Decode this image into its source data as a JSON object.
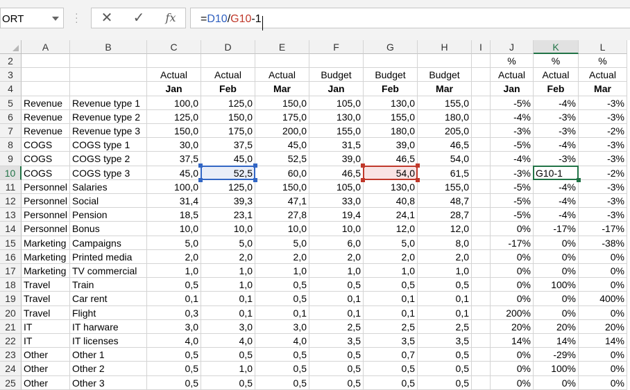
{
  "name_box": {
    "value": "ORT"
  },
  "formula_bar": {
    "cancel_icon": "✕",
    "enter_icon": "✓",
    "fx_label": "fx",
    "formula_parts": [
      {
        "text": "=",
        "color": "#000000"
      },
      {
        "text": "D10",
        "color": "#2f5fbf"
      },
      {
        "text": "/",
        "color": "#000000"
      },
      {
        "text": "G10",
        "color": "#c0392b"
      },
      {
        "text": "-1",
        "color": "#000000"
      }
    ]
  },
  "colors": {
    "ref1_border": "#3266c4",
    "ref1_fill": "#e9eef8",
    "ref2_border": "#c0392b",
    "ref2_fill": "#f9e4e4",
    "active_border": "#217346",
    "header_selected": "#217346"
  },
  "grid": {
    "columns": [
      "A",
      "B",
      "C",
      "D",
      "E",
      "F",
      "G",
      "H",
      "I",
      "J",
      "K",
      "L"
    ],
    "selected_column": "K",
    "selected_row": "10",
    "rows": [
      {
        "num": "2",
        "cells": [
          "",
          "",
          "",
          "",
          "",
          "",
          "",
          "",
          "",
          "%",
          "%",
          "%"
        ]
      },
      {
        "num": "3",
        "cells": [
          "",
          "",
          "Actual",
          "Actual",
          "Actual",
          "Budget",
          "Budget",
          "Budget",
          "",
          "Actual",
          "Actual",
          "Actual"
        ]
      },
      {
        "num": "4",
        "cells": [
          "",
          "",
          "Jan",
          "Feb",
          "Mar",
          "Jan",
          "Feb",
          "Mar",
          "",
          "Jan",
          "Feb",
          "Mar"
        ]
      },
      {
        "num": "5",
        "cells": [
          "Revenue",
          "Revenue type 1",
          "100,0",
          "125,0",
          "150,0",
          "105,0",
          "130,0",
          "155,0",
          "",
          "-5%",
          "-4%",
          "-3%"
        ]
      },
      {
        "num": "6",
        "cells": [
          "Revenue",
          "Revenue type 2",
          "125,0",
          "150,0",
          "175,0",
          "130,0",
          "155,0",
          "180,0",
          "",
          "-4%",
          "-3%",
          "-3%"
        ]
      },
      {
        "num": "7",
        "cells": [
          "Revenue",
          "Revenue type 3",
          "150,0",
          "175,0",
          "200,0",
          "155,0",
          "180,0",
          "205,0",
          "",
          "-3%",
          "-3%",
          "-2%"
        ]
      },
      {
        "num": "8",
        "cells": [
          "COGS",
          "COGS type 1",
          "30,0",
          "37,5",
          "45,0",
          "31,5",
          "39,0",
          "46,5",
          "",
          "-5%",
          "-4%",
          "-3%"
        ]
      },
      {
        "num": "9",
        "cells": [
          "COGS",
          "COGS type 2",
          "37,5",
          "45,0",
          "52,5",
          "39,0",
          "46,5",
          "54,0",
          "",
          "-4%",
          "-3%",
          "-3%"
        ]
      },
      {
        "num": "10",
        "cells": [
          "COGS",
          "COGS type 3",
          "45,0",
          "52,5",
          "60,0",
          "46,5",
          "54,0",
          "61,5",
          "",
          "-3%",
          "G10-1",
          "-2%"
        ]
      },
      {
        "num": "11",
        "cells": [
          "Personnel",
          "Salaries",
          "100,0",
          "125,0",
          "150,0",
          "105,0",
          "130,0",
          "155,0",
          "",
          "-5%",
          "-4%",
          "-3%"
        ]
      },
      {
        "num": "12",
        "cells": [
          "Personnel",
          "Social",
          "31,4",
          "39,3",
          "47,1",
          "33,0",
          "40,8",
          "48,7",
          "",
          "-5%",
          "-4%",
          "-3%"
        ]
      },
      {
        "num": "13",
        "cells": [
          "Personnel",
          "Pension",
          "18,5",
          "23,1",
          "27,8",
          "19,4",
          "24,1",
          "28,7",
          "",
          "-5%",
          "-4%",
          "-3%"
        ]
      },
      {
        "num": "14",
        "cells": [
          "Personnel",
          "Bonus",
          "10,0",
          "10,0",
          "10,0",
          "10,0",
          "12,0",
          "12,0",
          "",
          "0%",
          "-17%",
          "-17%"
        ]
      },
      {
        "num": "15",
        "cells": [
          "Marketing",
          "Campaigns",
          "5,0",
          "5,0",
          "5,0",
          "6,0",
          "5,0",
          "8,0",
          "",
          "-17%",
          "0%",
          "-38%"
        ]
      },
      {
        "num": "16",
        "cells": [
          "Marketing",
          "Printed media",
          "2,0",
          "2,0",
          "2,0",
          "2,0",
          "2,0",
          "2,0",
          "",
          "0%",
          "0%",
          "0%"
        ]
      },
      {
        "num": "17",
        "cells": [
          "Marketing",
          "TV commercial",
          "1,0",
          "1,0",
          "1,0",
          "1,0",
          "1,0",
          "1,0",
          "",
          "0%",
          "0%",
          "0%"
        ]
      },
      {
        "num": "18",
        "cells": [
          "Travel",
          "Train",
          "0,5",
          "1,0",
          "0,5",
          "0,5",
          "0,5",
          "0,5",
          "",
          "0%",
          "100%",
          "0%"
        ]
      },
      {
        "num": "19",
        "cells": [
          "Travel",
          "Car rent",
          "0,1",
          "0,1",
          "0,5",
          "0,1",
          "0,1",
          "0,1",
          "",
          "0%",
          "0%",
          "400%"
        ]
      },
      {
        "num": "20",
        "cells": [
          "Travel",
          "Flight",
          "0,3",
          "0,1",
          "0,1",
          "0,1",
          "0,1",
          "0,1",
          "",
          "200%",
          "0%",
          "0%"
        ]
      },
      {
        "num": "21",
        "cells": [
          "IT",
          "IT harware",
          "3,0",
          "3,0",
          "3,0",
          "2,5",
          "2,5",
          "2,5",
          "",
          "20%",
          "20%",
          "20%"
        ]
      },
      {
        "num": "22",
        "cells": [
          "IT",
          "IT licenses",
          "4,0",
          "4,0",
          "4,0",
          "3,5",
          "3,5",
          "3,5",
          "",
          "14%",
          "14%",
          "14%"
        ]
      },
      {
        "num": "23",
        "cells": [
          "Other",
          "Other 1",
          "0,5",
          "0,5",
          "0,5",
          "0,5",
          "0,7",
          "0,5",
          "",
          "0%",
          "-29%",
          "0%"
        ]
      },
      {
        "num": "24",
        "cells": [
          "Other",
          "Other 2",
          "0,5",
          "1,0",
          "0,5",
          "0,5",
          "0,5",
          "0,5",
          "",
          "0%",
          "100%",
          "0%"
        ]
      },
      {
        "num": "25",
        "cells": [
          "Other",
          "Other 3",
          "0,5",
          "0,5",
          "0,5",
          "0,5",
          "0,5",
          "0,5",
          "",
          "0%",
          "0%",
          "0%"
        ]
      }
    ]
  }
}
